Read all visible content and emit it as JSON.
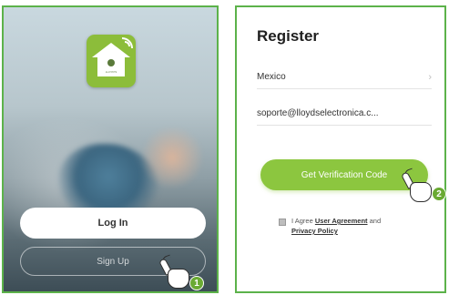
{
  "left_screen": {
    "logo_brand": "LLOYD'S",
    "login_label": "Log In",
    "signup_label": "Sign Up",
    "step_badge": "1"
  },
  "right_screen": {
    "title": "Register",
    "country_value": "Mexico",
    "country_chevron": "›",
    "email_value": "soporte@lloydselectronica.c...",
    "verify_label": "Get Verification Code",
    "agree_prefix": "I Agree ",
    "agree_link1": "User Agreement",
    "agree_mid": " and ",
    "agree_link2": "Privacy Policy",
    "step_badge": "2"
  },
  "colors": {
    "frame_green": "#5cb24a",
    "accent_green": "#8cc63f",
    "logo_green": "#8cbd3a",
    "badge_green": "#6aaa33"
  },
  "icons": [
    "house-wifi-logo-icon",
    "chevron-right-icon",
    "tap-hand-icon"
  ]
}
